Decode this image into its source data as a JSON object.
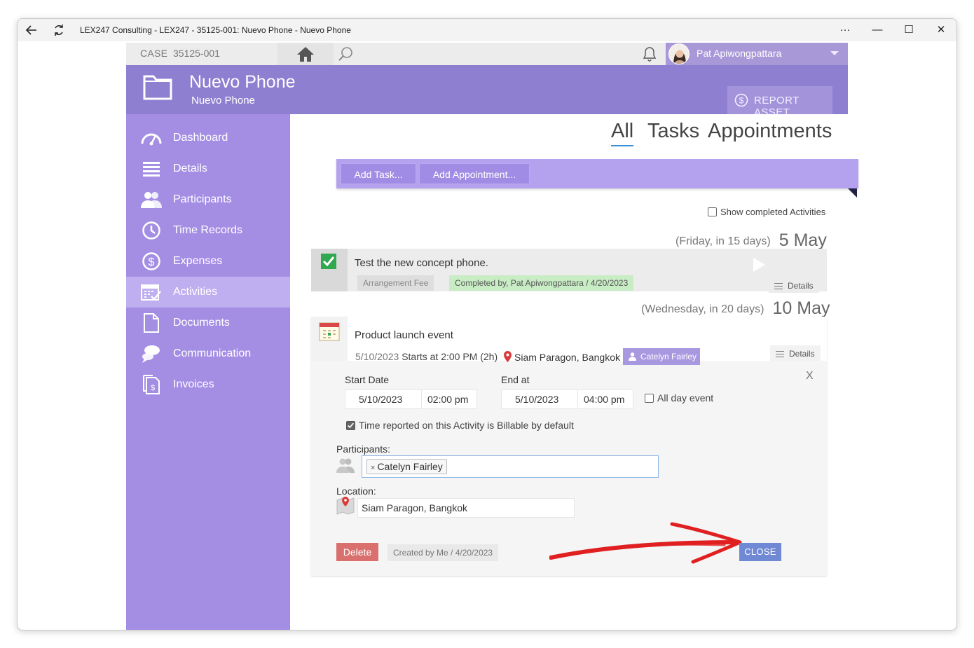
{
  "window": {
    "title": "LEX247 Consulting - LEX247 - 35125-001: Nuevo Phone - Nuevo Phone",
    "controls": {
      "more": "···",
      "minimize": "—",
      "maximize": "☐",
      "close": "✕"
    }
  },
  "topbar": {
    "case_label": "CASE",
    "case_number": "35125-001",
    "user_name": "Pat Apiwongpattara"
  },
  "header": {
    "title": "Nuevo Phone",
    "subtitle": "Nuevo Phone",
    "report_button": "REPORT ASSET"
  },
  "sidebar": {
    "items": [
      {
        "label": "Dashboard",
        "icon": "gauge-icon"
      },
      {
        "label": "Details",
        "icon": "list-icon"
      },
      {
        "label": "Participants",
        "icon": "people-icon"
      },
      {
        "label": "Time Records",
        "icon": "clock-icon"
      },
      {
        "label": "Expenses",
        "icon": "dollar-icon"
      },
      {
        "label": "Activities",
        "icon": "calendar-check-icon",
        "active": true
      },
      {
        "label": "Documents",
        "icon": "document-icon"
      },
      {
        "label": "Communication",
        "icon": "chat-bubbles-icon"
      },
      {
        "label": "Invoices",
        "icon": "invoice-icon"
      }
    ]
  },
  "main": {
    "tabs": [
      {
        "label": "All",
        "active": true
      },
      {
        "label": "Tasks"
      },
      {
        "label": "Appointments"
      }
    ],
    "actions": {
      "add_task": "Add Task...",
      "add_appointment": "Add Appointment..."
    },
    "show_completed": {
      "label": "Show completed Activities",
      "checked": false
    },
    "groups": [
      {
        "relative": "(Friday, in 15 days)",
        "date": "5 May",
        "task": {
          "title": "Test the new concept phone.",
          "fee_tag": "Arrangement Fee",
          "completed_tag": "Completed by, Pat Apiwongpattara / 4/20/2023",
          "details": "Details"
        }
      },
      {
        "relative": "(Wednesday, in 20 days)",
        "date": "10 May",
        "appointment": {
          "title": "Product launch event",
          "date": "5/10/2023",
          "starts": "Starts at 2:00 PM (2h)",
          "location": "Siam Paragon, Bangkok",
          "person": "Catelyn Fairley",
          "details": "Details"
        }
      }
    ],
    "editor": {
      "close_x": "X",
      "start_label": "Start Date",
      "start_date": "5/10/2023",
      "start_time": "02:00 pm",
      "end_label": "End at",
      "end_date": "5/10/2023",
      "end_time": "04:00 pm",
      "all_day": {
        "label": "All day event",
        "checked": false
      },
      "billable": {
        "label": "Time reported on this Activity is Billable by default",
        "checked": true
      },
      "participants_label": "Participants:",
      "participant": "Catelyn Fairley",
      "participant_remove": "×",
      "location_label": "Location:",
      "location_value": "Siam Paragon, Bangkok",
      "delete_button": "Delete",
      "created": "Created by Me / 4/20/2023",
      "close_button": "CLOSE"
    }
  },
  "colors": {
    "sidebar": "#a48ee4",
    "header": "#8f7fd1",
    "action_bar": "#b4a2ee",
    "delete": "#d9706d",
    "close": "#6f89d4",
    "annotation_arrow": "#e02020"
  }
}
